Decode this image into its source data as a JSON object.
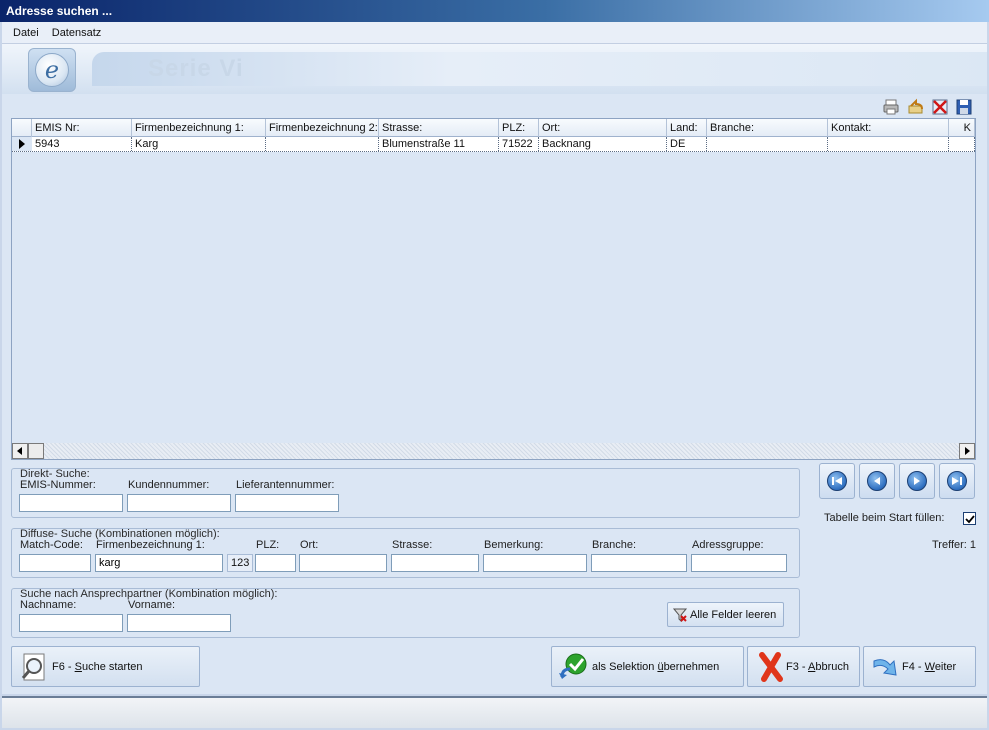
{
  "window": {
    "title": "Adresse suchen ..."
  },
  "menu": [
    {
      "label": "Datei"
    },
    {
      "label": "Datensatz"
    }
  ],
  "banner": {
    "logo_letter": "e",
    "product": "Serie Vi"
  },
  "toolbar_icons": [
    "printer-icon",
    "undo-icon",
    "delete-icon",
    "save-icon"
  ],
  "grid": {
    "columns": [
      "EMIS Nr:",
      "Firmenbezeichnung 1:",
      "Firmenbezeichnung 2:",
      "Strasse:",
      "PLZ:",
      "Ort:",
      "Land:",
      "Branche:",
      "Kontakt:",
      "K"
    ],
    "rows": [
      [
        "5943",
        "Karg",
        "",
        "Blumenstraße 11",
        "71522",
        "Backnang",
        "DE",
        "",
        "",
        ""
      ]
    ]
  },
  "direkt": {
    "legend": "Direkt- Suche:",
    "emis_label": "EMIS-Nummer:",
    "emis_value": "",
    "kunden_label": "Kundennummer:",
    "kunden_value": "",
    "liefer_label": "Lieferantennummer:",
    "liefer_value": ""
  },
  "diffuse": {
    "legend": "Diffuse- Suche (Kombinationen möglich):",
    "matchcode_label": "Match-Code:",
    "matchcode_value": "",
    "firma_label": "Firmenbezeichnung 1:",
    "firma_value": "karg",
    "num_badge": "123",
    "plz_label": "PLZ:",
    "plz_value": "",
    "ort_label": "Ort:",
    "ort_value": "",
    "strasse_label": "Strasse:",
    "strasse_value": "",
    "bemerkung_label": "Bemerkung:",
    "bemerkung_value": "",
    "branche_label": "Branche:",
    "branche_value": "",
    "adressgruppe_label": "Adressgruppe:",
    "adressgruppe_value": ""
  },
  "ansprech": {
    "legend": "Suche nach Ansprechpartner (Kombination möglich):",
    "nachname_label": "Nachname:",
    "nachname_value": "",
    "vorname_label": "Vorname:",
    "vorname_value": "",
    "clear_label": "Alle Felder leeren"
  },
  "side": {
    "fill_label": "Tabelle beim Start füllen:",
    "fill_checked": true,
    "hits": "Treffer: 1"
  },
  "buttons": {
    "search_key": "F6 - ",
    "search_ul": "S",
    "search_rest": "uche starten",
    "select_pre": "als Selektion ",
    "select_ul": "ü",
    "select_rest": "bernehmen",
    "abort_pre": "F3 - ",
    "abort_ul": "A",
    "abort_rest": "bbruch",
    "next_pre": "F4 - ",
    "next_ul": "W",
    "next_rest": "eiter"
  },
  "colors": {
    "title_start": "#0a246a",
    "title_end": "#a6caf0",
    "panel": "#dbe6f4",
    "accent": "#2f6fc0"
  }
}
